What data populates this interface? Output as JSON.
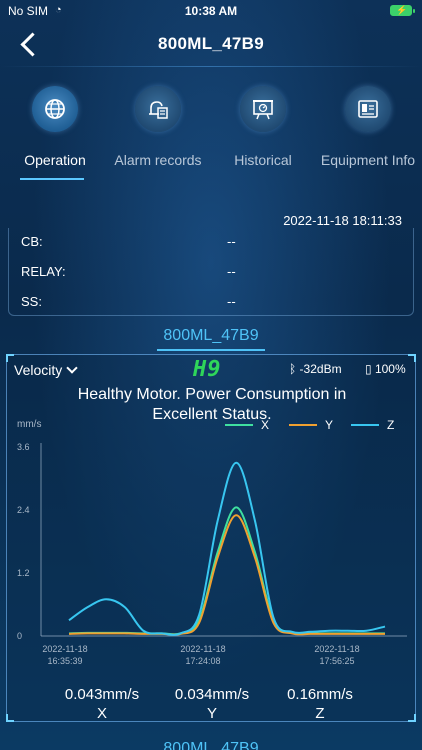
{
  "status_bar": {
    "carrier": "No SIM",
    "time": "10:38 AM"
  },
  "nav": {
    "title": "800ML_47B9"
  },
  "tabs": [
    {
      "label": "Operation",
      "icon": "globe-icon",
      "active": true
    },
    {
      "label": "Alarm records",
      "icon": "bell-list-icon",
      "active": false
    },
    {
      "label": "Historical",
      "icon": "presentation-chart-icon",
      "active": false
    },
    {
      "label": "Equipment Info",
      "icon": "device-info-icon",
      "active": false
    }
  ],
  "info": {
    "timestamp": "2022-11-18 18:11:33",
    "rows": [
      {
        "label": "CB:",
        "value": "--"
      },
      {
        "label": "RELAY:",
        "value": "--"
      },
      {
        "label": "SS:",
        "value": "--"
      }
    ]
  },
  "device": {
    "name": "800ML_47B9",
    "next_name": "800ML_47B9"
  },
  "card": {
    "metric": "Velocity",
    "health_code": "H9",
    "signal": "-32dBm",
    "battery": "100%",
    "message_line1": "Healthy Motor.  Power Consumption in",
    "message_line2": "Excellent Status.",
    "readings": [
      {
        "value": "0.043mm/s",
        "axis": "X"
      },
      {
        "value": "0.034mm/s",
        "axis": "Y"
      },
      {
        "value": "0.16mm/s",
        "axis": "Z"
      }
    ]
  },
  "chart_data": {
    "type": "line",
    "ylabel": "mm/s",
    "ylim": [
      0,
      3.6
    ],
    "yticks": [
      "3.6",
      "2.4",
      "1.2",
      "0"
    ],
    "xticks": [
      {
        "date": "2022-11-18",
        "time": "16:35:39"
      },
      {
        "date": "2022-11-18",
        "time": "17:24:08"
      },
      {
        "date": "2022-11-18",
        "time": "17:56:25"
      }
    ],
    "legend_position": "top-right",
    "series": [
      {
        "name": "X",
        "color": "#3fe0a0",
        "values": [
          0.05,
          0.06,
          0.06,
          0.06,
          0.05,
          0.05,
          0.05,
          0.3,
          1.6,
          2.45,
          1.6,
          0.3,
          0.06,
          0.05,
          0.05,
          0.05,
          0.05,
          0.05
        ]
      },
      {
        "name": "Y",
        "color": "#f0a030",
        "values": [
          0.04,
          0.05,
          0.05,
          0.05,
          0.04,
          0.04,
          0.04,
          0.25,
          1.5,
          2.3,
          1.5,
          0.25,
          0.05,
          0.04,
          0.04,
          0.04,
          0.04,
          0.04
        ]
      },
      {
        "name": "Z",
        "color": "#38c6f0",
        "values": [
          0.3,
          0.55,
          0.7,
          0.55,
          0.1,
          0.05,
          0.05,
          0.4,
          2.2,
          3.3,
          2.2,
          0.35,
          0.08,
          0.08,
          0.1,
          0.1,
          0.1,
          0.18
        ]
      }
    ]
  }
}
